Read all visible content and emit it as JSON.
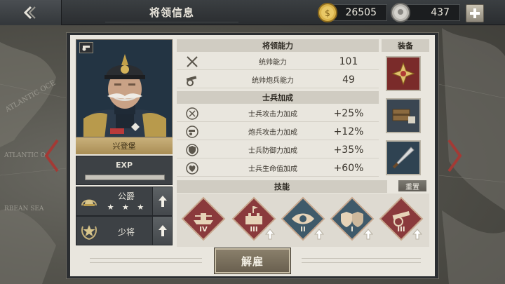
{
  "header": {
    "title": "将领信息",
    "gold": "26505",
    "silver": "437"
  },
  "map": {
    "labels": [
      "ATLANTIC OCE",
      "ATLANTIC O",
      "RBEAN SEA"
    ]
  },
  "general": {
    "name": "兴登堡",
    "exp_label": "EXP",
    "exp_progress": 0.0,
    "title_rank": "公爵",
    "title_stars": 3,
    "title_stars_display": "★ ★ ★",
    "military_rank": "少将"
  },
  "abilities": {
    "heading": "将领能力",
    "rows": [
      {
        "icon": "crossed-swords-icon",
        "label": "统帅能力",
        "value": "101"
      },
      {
        "icon": "cannon-icon",
        "label": "统帅炮兵能力",
        "value": "49"
      }
    ]
  },
  "soldier_bonus": {
    "heading": "士兵加成",
    "rows": [
      {
        "icon": "attack-up-icon",
        "label": "士兵攻击力加成",
        "value": "+25%"
      },
      {
        "icon": "artillery-up-icon",
        "label": "炮兵攻击力加成",
        "value": "+12%"
      },
      {
        "icon": "shield-up-icon",
        "label": "士兵防御力加成",
        "value": "+35%"
      },
      {
        "icon": "heart-up-icon",
        "label": "士兵生命值加成",
        "value": "+60%"
      }
    ]
  },
  "equipment": {
    "heading": "装备",
    "items": [
      "medal-cross-icon",
      "ammo-box-icon",
      "dagger-icon"
    ]
  },
  "skills": {
    "heading": "技能",
    "reset_label": "重置",
    "items": [
      {
        "icon": "warship-icon",
        "level": "IV",
        "color": "#8a3a3c"
      },
      {
        "icon": "fortress-icon",
        "level": "III",
        "color": "#8a3a3c"
      },
      {
        "icon": "eye-icon",
        "level": "II",
        "color": "#3f5a6a"
      },
      {
        "icon": "shields-icon",
        "level": "I",
        "color": "#3f5a6a"
      },
      {
        "icon": "cannon-icon",
        "level": "III",
        "color": "#8a3a3c"
      }
    ]
  },
  "footer": {
    "dismiss_label": "解雇"
  },
  "colors": {
    "panel": "#e9e6de",
    "gold_bar": "#c9b07b",
    "red_skill": "#8a3a3c",
    "blue_skill": "#3f5a6a"
  }
}
